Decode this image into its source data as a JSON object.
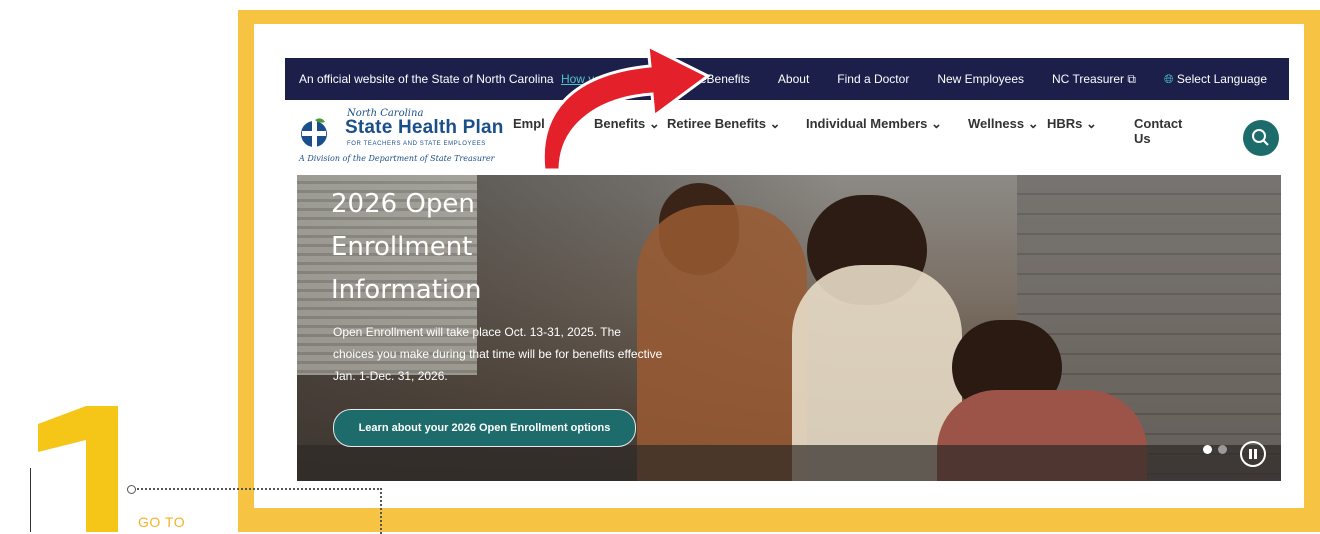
{
  "topbar": {
    "official_text": "An official website of the State of North Carolina",
    "how_link": "How you kno",
    "links": [
      "eBenefits",
      "About",
      "Find a Doctor",
      "New Employees",
      "NC Treasurer",
      "Select Language"
    ]
  },
  "logo": {
    "line1": "North Carolina",
    "line2": "State Health Plan",
    "line3": "FOR TEACHERS AND STATE EMPLOYEES",
    "line4": "A Division of the Department of State Treasurer"
  },
  "nav": {
    "items": [
      "Empl",
      "Benefits",
      "Retiree Benefits",
      "Individual Members",
      "Wellness",
      "HBRs",
      "Contact",
      "Us"
    ]
  },
  "hero": {
    "title_lines": [
      "2026 Open",
      "Enrollment",
      "Information"
    ],
    "description": "Open Enrollment will take place Oct. 13-31, 2025. The choices you make during that time will be for benefits effective Jan. 1-Dec. 31, 2026.",
    "cta": "Learn about your 2026 Open Enrollment options"
  },
  "step": {
    "number": "1",
    "label": "GO TO"
  },
  "colors": {
    "frame": "#f7c342",
    "topbar": "#1b1f4a",
    "accent": "#1e6b6b",
    "arrow": "#e4202a"
  }
}
